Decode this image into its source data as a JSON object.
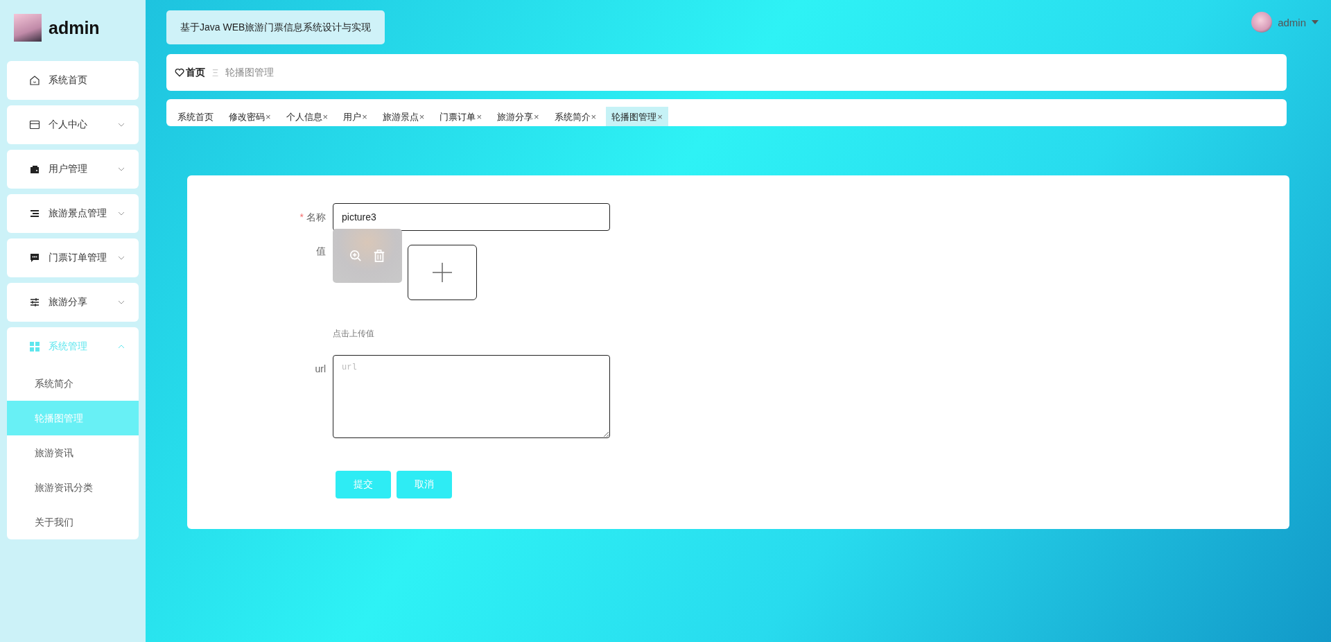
{
  "sidebar": {
    "brand": "admin",
    "items": [
      {
        "kind": "link",
        "label": "系统首页"
      },
      {
        "kind": "group",
        "label": "个人中心",
        "expanded": false
      },
      {
        "kind": "group",
        "label": "用户管理",
        "expanded": false
      },
      {
        "kind": "group",
        "label": "旅游景点管理",
        "expanded": false
      },
      {
        "kind": "group",
        "label": "门票订单管理",
        "expanded": false
      },
      {
        "kind": "group",
        "label": "旅游分享",
        "expanded": false
      },
      {
        "kind": "group",
        "label": "系统管理",
        "expanded": true,
        "children": [
          {
            "label": "系统简介",
            "selected": false
          },
          {
            "label": "轮播图管理",
            "selected": true
          },
          {
            "label": "旅游资讯",
            "selected": false
          },
          {
            "label": "旅游资讯分类",
            "selected": false
          },
          {
            "label": "关于我们",
            "selected": false
          }
        ]
      }
    ]
  },
  "header": {
    "title": "基于Java WEB旅游门票信息系统设计与实现",
    "user": "admin"
  },
  "breadcrumb": {
    "home": "首页",
    "separator": "Ξ",
    "current": "轮播图管理"
  },
  "tabs": [
    {
      "label": "系统首页",
      "selected": false
    },
    {
      "label": "修改密码",
      "close": "×",
      "selected": false
    },
    {
      "label": "个人信息",
      "close": "×",
      "selected": false
    },
    {
      "label": "用户",
      "close": "×",
      "selected": false
    },
    {
      "label": "旅游景点",
      "close": "×",
      "selected": false
    },
    {
      "label": "门票订单",
      "close": "×",
      "selected": false
    },
    {
      "label": "旅游分享",
      "close": "×",
      "selected": false
    },
    {
      "label": "系统简介",
      "close": "×",
      "selected": false
    },
    {
      "label": "轮播图管理",
      "close": "×",
      "selected": true
    }
  ],
  "form": {
    "fields": [
      {
        "kind": "text",
        "label": "名称",
        "required_mark": "*",
        "value": "picture3"
      },
      {
        "kind": "upload",
        "label": "值",
        "hint": "点击上传值"
      },
      {
        "kind": "textarea",
        "label": "url",
        "placeholder": "url"
      }
    ],
    "buttons": [
      "提交",
      "取消"
    ]
  }
}
